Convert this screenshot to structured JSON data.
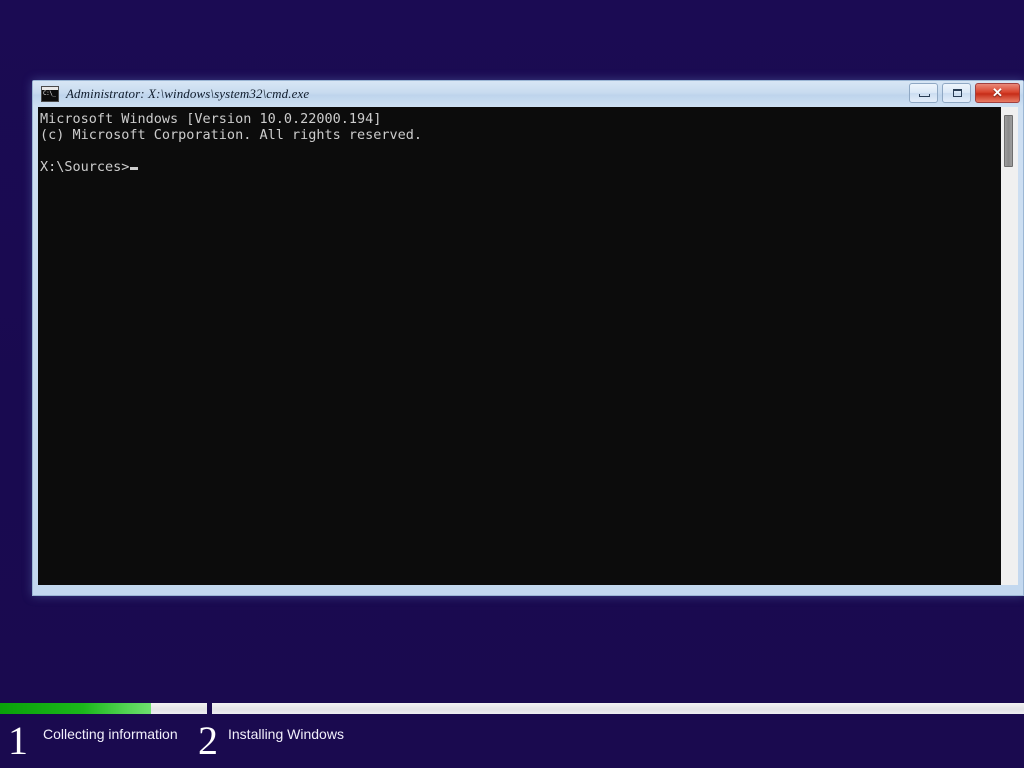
{
  "desktop": {
    "background_top": "#1b0b53",
    "background_bottom": "#1a0a4f"
  },
  "cmd_window": {
    "title": "Administrator: X:\\windows\\system32\\cmd.exe",
    "icon_name": "cmd-icon",
    "controls": {
      "minimize_label": "",
      "maximize_label": "",
      "close_label": "✕"
    },
    "console": {
      "line1": "Microsoft Windows [Version 10.0.22000.194]",
      "line2": "(c) Microsoft Corporation. All rights reserved.",
      "line3": "",
      "prompt": "X:\\Sources>",
      "background": "#0c0c0c",
      "foreground": "#cccccc"
    }
  },
  "setup_footer": {
    "progress_color": "#1bb81b",
    "track_color": "#ededf2",
    "progress_percent": 73,
    "steps": [
      {
        "number": "1",
        "label": "Collecting information",
        "active": true
      },
      {
        "number": "2",
        "label": "Installing Windows",
        "active": false
      }
    ]
  }
}
